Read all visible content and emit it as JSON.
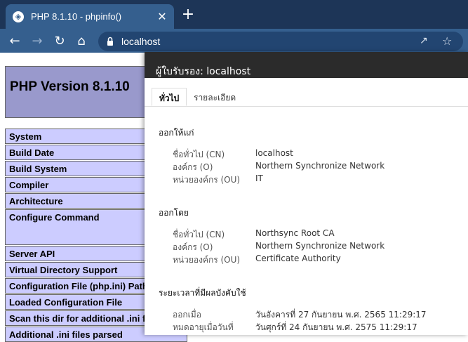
{
  "browser": {
    "tab_title": "PHP 8.1.10 - phpinfo()",
    "url": "localhost"
  },
  "phpinfo": {
    "version_title": "PHP Version 8.1.10",
    "rows": [
      "System",
      "Build Date",
      "Build System",
      "Compiler",
      "Architecture",
      "Configure Command",
      "Server API",
      "Virtual Directory Support",
      "Configuration File (php.ini) Path",
      "Loaded Configuration File",
      "Scan this dir for additional .ini files",
      "Additional .ini files parsed"
    ]
  },
  "certificate": {
    "header": "ผู้ใบรับรอง: localhost",
    "tabs": [
      "ทั่วไป",
      "รายละเอียด"
    ],
    "issued_to_title": "ออกให้แก่",
    "issued_to": [
      {
        "label": "ชื่อทั่วไป (CN)",
        "value": "localhost"
      },
      {
        "label": "องค์กร (O)",
        "value": "Northern Synchronize Network"
      },
      {
        "label": "หน่วยองค์กร (OU)",
        "value": "IT"
      }
    ],
    "issued_by_title": "ออกโดย",
    "issued_by": [
      {
        "label": "ชื่อทั่วไป (CN)",
        "value": "Northsync Root CA"
      },
      {
        "label": "องค์กร (O)",
        "value": "Northern Synchronize Network"
      },
      {
        "label": "หน่วยองค์กร (OU)",
        "value": "Certificate Authority"
      }
    ],
    "validity_title": "ระยะเวลาที่มีผลบังคับใช้",
    "validity": [
      {
        "label": "ออกเมื่อ",
        "value": "วันอังคารที่ 27 กันยายน พ.ศ. 2565 11:29:17"
      },
      {
        "label": "หมดอายุเมื่อวันที่",
        "value": "วันศุกร์ที่ 24 กันยายน พ.ศ. 2575 11:29:17"
      }
    ]
  },
  "colors": {
    "tabstrip": "#1d3557",
    "toolbar": "#355f8e",
    "php_header": "#9999cc",
    "php_row": "#ccccff",
    "dialog_header": "#2b2b2b"
  }
}
